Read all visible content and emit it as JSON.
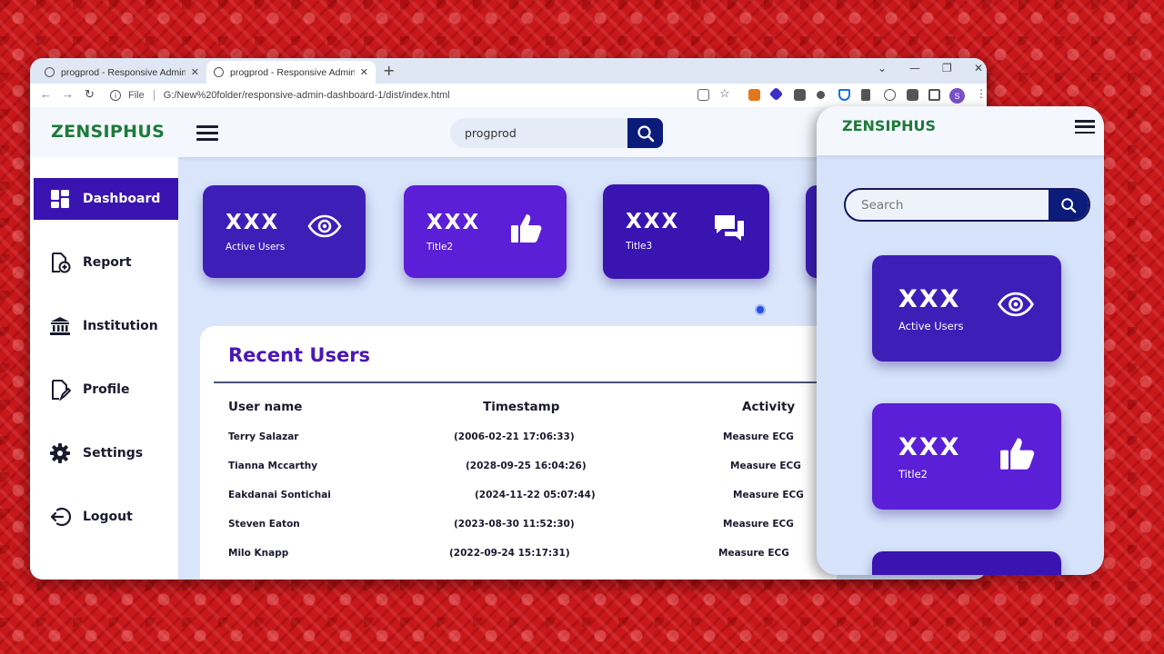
{
  "browser": {
    "tabs": [
      {
        "title": "progprod - Responsive Admin Da",
        "close": "✕"
      },
      {
        "title": "progprod - Responsive Admin Da",
        "close": "✕"
      }
    ],
    "new_tab": "+",
    "window_controls": [
      "⌄",
      "—",
      "❐",
      "✕"
    ],
    "nav": {
      "back": "←",
      "forward": "→",
      "reload": "↻"
    },
    "info_label": "File",
    "url": "G:/New%20folder/responsive-admin-dashboard-1/dist/index.html",
    "profile_initial": "S",
    "extension_colors": [
      "#e2761b",
      "#3b2fc9",
      "#555555",
      "#555555",
      "#1a73e8",
      "#555555",
      "#555555",
      "#555555",
      "#555555"
    ]
  },
  "app": {
    "logo": "ZENSIPHUS",
    "search_value": "progprod",
    "accent": "#3d1fb8",
    "brand_green": "#1e7a3a"
  },
  "sidebar": {
    "items": [
      {
        "label": "Dashboard",
        "icon": "grid-icon",
        "active": true
      },
      {
        "label": "Report",
        "icon": "report-add-icon",
        "active": false
      },
      {
        "label": "Institution",
        "icon": "bank-icon",
        "active": false
      },
      {
        "label": "Profile",
        "icon": "profile-doc-icon",
        "active": false
      },
      {
        "label": "Settings",
        "icon": "gear-icon",
        "active": false
      },
      {
        "label": "Logout",
        "icon": "logout-icon",
        "active": false
      }
    ]
  },
  "cards": [
    {
      "value": "XXX",
      "caption": "Active Users",
      "icon": "eye-icon",
      "color": "#3d1fb8"
    },
    {
      "value": "XXX",
      "caption": "Title2",
      "icon": "thumbs-up-icon",
      "color": "#5a1fd6"
    },
    {
      "value": "XXX",
      "caption": "Title3",
      "icon": "chat-icon",
      "color": "#3a14b0"
    }
  ],
  "recent_users": {
    "title": "Recent Users",
    "columns": [
      "User name",
      "Timestamp",
      "Activity"
    ],
    "rows": [
      {
        "name": "Terry Salazar",
        "timestamp": "(2006-02-21 17:06:33)",
        "activity": "Measure ECG"
      },
      {
        "name": "Tianna Mccarthy",
        "timestamp": "(2028-09-25 16:04:26)",
        "activity": "Measure ECG"
      },
      {
        "name": "Eakdanai Sontichai",
        "timestamp": "(2024-11-22 05:07:44)",
        "activity": "Measure ECG"
      },
      {
        "name": "Steven Eaton",
        "timestamp": "(2023-08-30 11:52:30)",
        "activity": "Measure ECG"
      },
      {
        "name": "Milo Knapp",
        "timestamp": "(2022-09-24 15:17:31)",
        "activity": "Measure ECG"
      }
    ]
  },
  "mobile": {
    "logo": "ZENSIPHUS",
    "search_placeholder": "Search",
    "cards": [
      {
        "value": "XXX",
        "caption": "Active Users",
        "icon": "eye-icon",
        "color": "#3d1fb8"
      },
      {
        "value": "XXX",
        "caption": "Title2",
        "icon": "thumbs-up-icon",
        "color": "#5a1fd6"
      }
    ]
  }
}
